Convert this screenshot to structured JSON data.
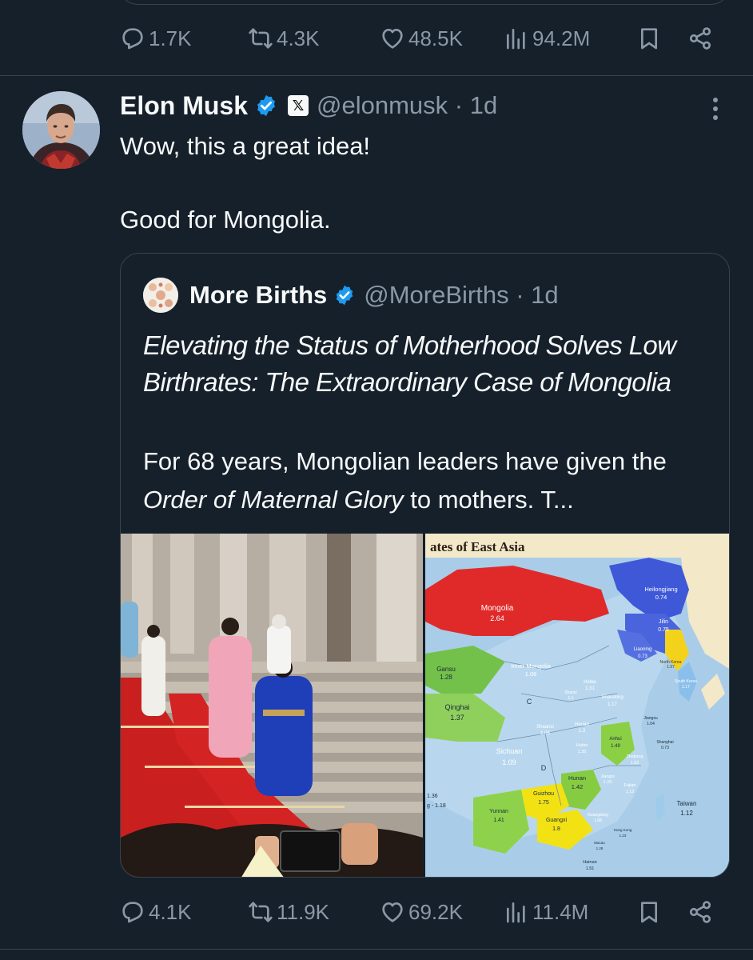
{
  "prev_tweet": {
    "actions": {
      "replies": "1.7K",
      "reposts": "4.3K",
      "likes": "48.5K",
      "views": "94.2M"
    }
  },
  "tweet": {
    "author": {
      "name": "Elon Musk",
      "handle": "@elonmusk",
      "time": "1d"
    },
    "text_line1": "Wow, this a great idea!",
    "text_line2": "Good for Mongolia.",
    "actions": {
      "replies": "4.1K",
      "reposts": "11.9K",
      "likes": "69.2K",
      "views": "11.4M"
    }
  },
  "quote": {
    "author": {
      "name": "More Births",
      "handle": "@MoreBirths",
      "time": "1d"
    },
    "title": "Elevating the Status of Motherhood Solves Low Birthrates: The Extraordinary Case of Mongolia",
    "text_before": "For 68 years, Mongolian leaders have given the",
    "text_italic": "Order of Maternal Glory",
    "text_after": "to mothers. T..."
  },
  "map": {
    "title": "ates of East Asia",
    "regions": [
      {
        "name": "Mongolia",
        "value": "2.64"
      },
      {
        "name": "Heilongjiang",
        "value": "0.74"
      },
      {
        "name": "Jilin",
        "value": "0.75"
      },
      {
        "name": "Liaoning",
        "value": "0.73"
      },
      {
        "name": "North Korea",
        "value": "1.97"
      },
      {
        "name": "South Korea",
        "value": "1.17"
      },
      {
        "name": "Gansu",
        "value": "1.28"
      },
      {
        "name": "Inner Mongolia",
        "value": "1.06"
      },
      {
        "name": "Hebei",
        "value": "1.31"
      },
      {
        "name": "Shanxi",
        "value": "1.1"
      },
      {
        "name": "Shandong",
        "value": "1.17"
      },
      {
        "name": "Qinghai",
        "value": "1.37"
      },
      {
        "name": "Shaanxi",
        "value": "1.06"
      },
      {
        "name": "Henan",
        "value": "1.3"
      },
      {
        "name": "Jiangsu",
        "value": "1.04"
      },
      {
        "name": "Anhui",
        "value": "1.49"
      },
      {
        "name": "Shanghai",
        "value": "0.73"
      },
      {
        "name": "Sichuan",
        "value": "1.09"
      },
      {
        "name": "Hubei",
        "value": "1.35"
      },
      {
        "name": "Zhejiang",
        "value": "1.02"
      },
      {
        "name": "Hunan",
        "value": "1.42"
      },
      {
        "name": "Jiangxi",
        "value": "1.29"
      },
      {
        "name": "Fujian",
        "value": "1.12"
      },
      {
        "name": "Guizhou",
        "value": "1.75"
      },
      {
        "name": "Yunnan",
        "value": "1.41"
      },
      {
        "name": "Guangxi",
        "value": "1.8"
      },
      {
        "name": "Guangdong",
        "value": "1.08"
      },
      {
        "name": "Hong Kong",
        "value": "1.23"
      },
      {
        "name": "Macau",
        "value": "1.28"
      },
      {
        "name": "Taiwan",
        "value": "1.12"
      },
      {
        "name": "Hainan",
        "value": "1.51"
      }
    ],
    "edge_label_1": "1.36",
    "edge_label_2": "g - 1.18",
    "letter_c": "C",
    "letter_d": "D"
  },
  "colors": {
    "background": "#15202b",
    "border": "#38444d",
    "muted": "#8b98a5",
    "verified": "#1d9bf0"
  }
}
